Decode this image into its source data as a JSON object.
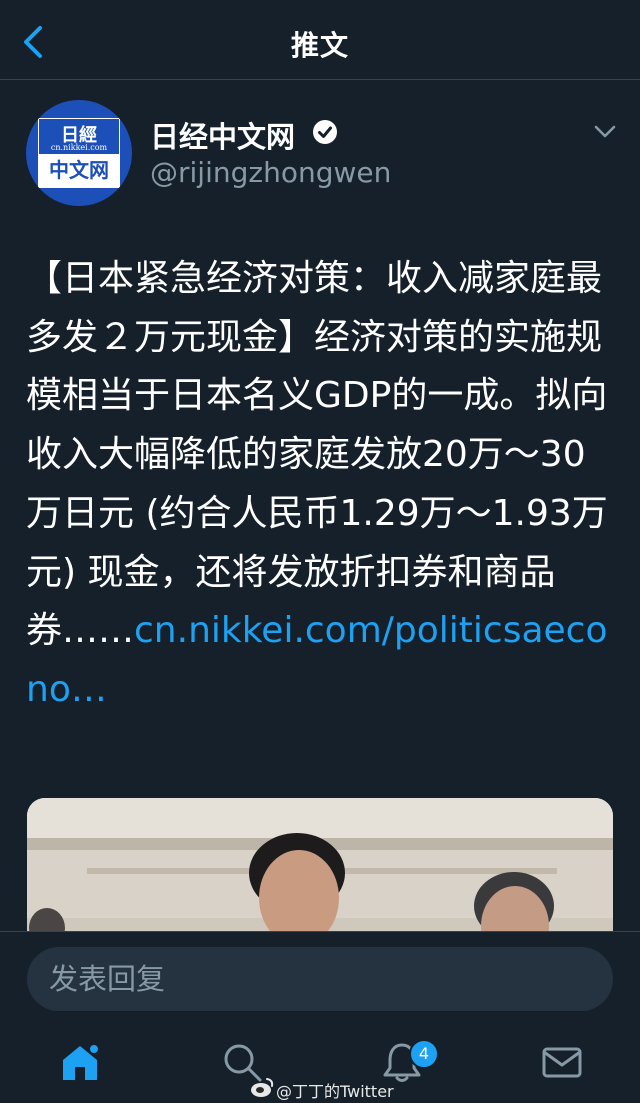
{
  "header": {
    "title": "推文"
  },
  "tweet": {
    "display_name": "日经中文网",
    "handle": "@rijingzhongwen",
    "text": "【日本紧急经济对策：收入减家庭最多发２万元现金】经济对策的实施规模相当于日本名义GDP的一成。拟向收入大幅降低的家庭发放20万～30万日元 (约合人民币1.29万～1.93万元) 现金，还将发放折扣券和商品券……",
    "link_text": "cn.nikkei.com/politicsaecono…",
    "avatar": {
      "top": "日經",
      "url": "cn.nikkei.com",
      "bottom": "中文网"
    }
  },
  "reply": {
    "placeholder": "发表回复"
  },
  "tabbar": {
    "notifications_badge": "4"
  },
  "watermark": {
    "text": "@丁丁的Twitter"
  },
  "colors": {
    "background": "#15202b",
    "accent": "#1da1f2",
    "muted": "#8899a6",
    "divider": "#38444d"
  },
  "icons": [
    "chevron-left-icon",
    "verified-badge-icon",
    "chevron-down-icon",
    "home-icon",
    "search-icon",
    "bell-icon",
    "mail-icon",
    "weibo-logo-icon"
  ]
}
